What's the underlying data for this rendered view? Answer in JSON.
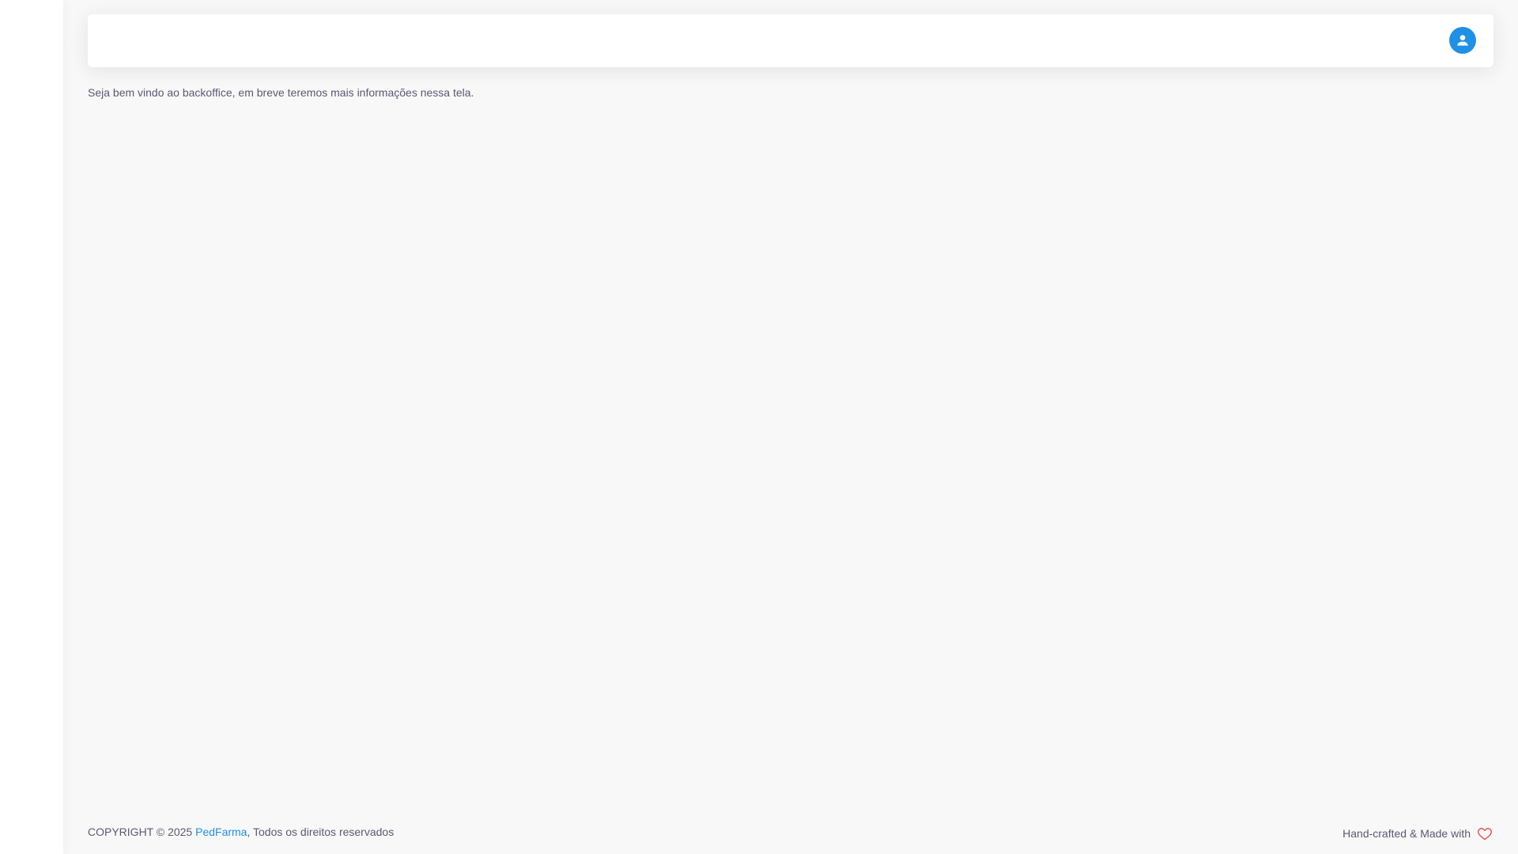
{
  "sidebar": {},
  "navbar": {
    "user_icon": "user-avatar-icon"
  },
  "main": {
    "welcome_text": "Seja bem vindo ao backoffice, em breve teremos mais informações nessa tela."
  },
  "footer": {
    "copyright_prefix": "COPYRIGHT © 2025 ",
    "brand_name": "PedFarma",
    "copyright_suffix": ", Todos os direitos reservados",
    "made_with_text": "Hand-crafted & Made with",
    "heart_icon": "heart-icon"
  },
  "colors": {
    "primary": "#1e90e6",
    "background": "#f8f8f8",
    "heart": "#ea5455"
  }
}
